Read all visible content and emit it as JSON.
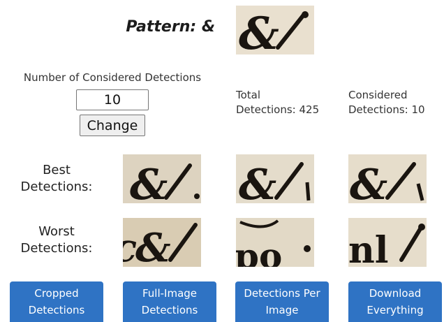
{
  "pattern": {
    "title": "Pattern: &",
    "glyph": "&"
  },
  "controls": {
    "count_label": "Number of Considered Detections",
    "count_value": "10",
    "change_label": "Change"
  },
  "stats": {
    "total_label": "Total",
    "total_text": "Detections: 425",
    "considered_label": "Considered",
    "considered_text": "Detections: 10"
  },
  "rows": {
    "best_label_1": "Best",
    "best_label_2": "Detections:",
    "worst_label_1": "Worst",
    "worst_label_2": "Detections:"
  },
  "actions": {
    "cropped": "Cropped Detections",
    "full_image": "Full-Image Detections",
    "per_image": "Detections Per Image",
    "download": "Download Everything"
  },
  "colors": {
    "button_blue": "#2f73c4",
    "parchment": "#e6dccb",
    "ink": "#1a1510"
  }
}
